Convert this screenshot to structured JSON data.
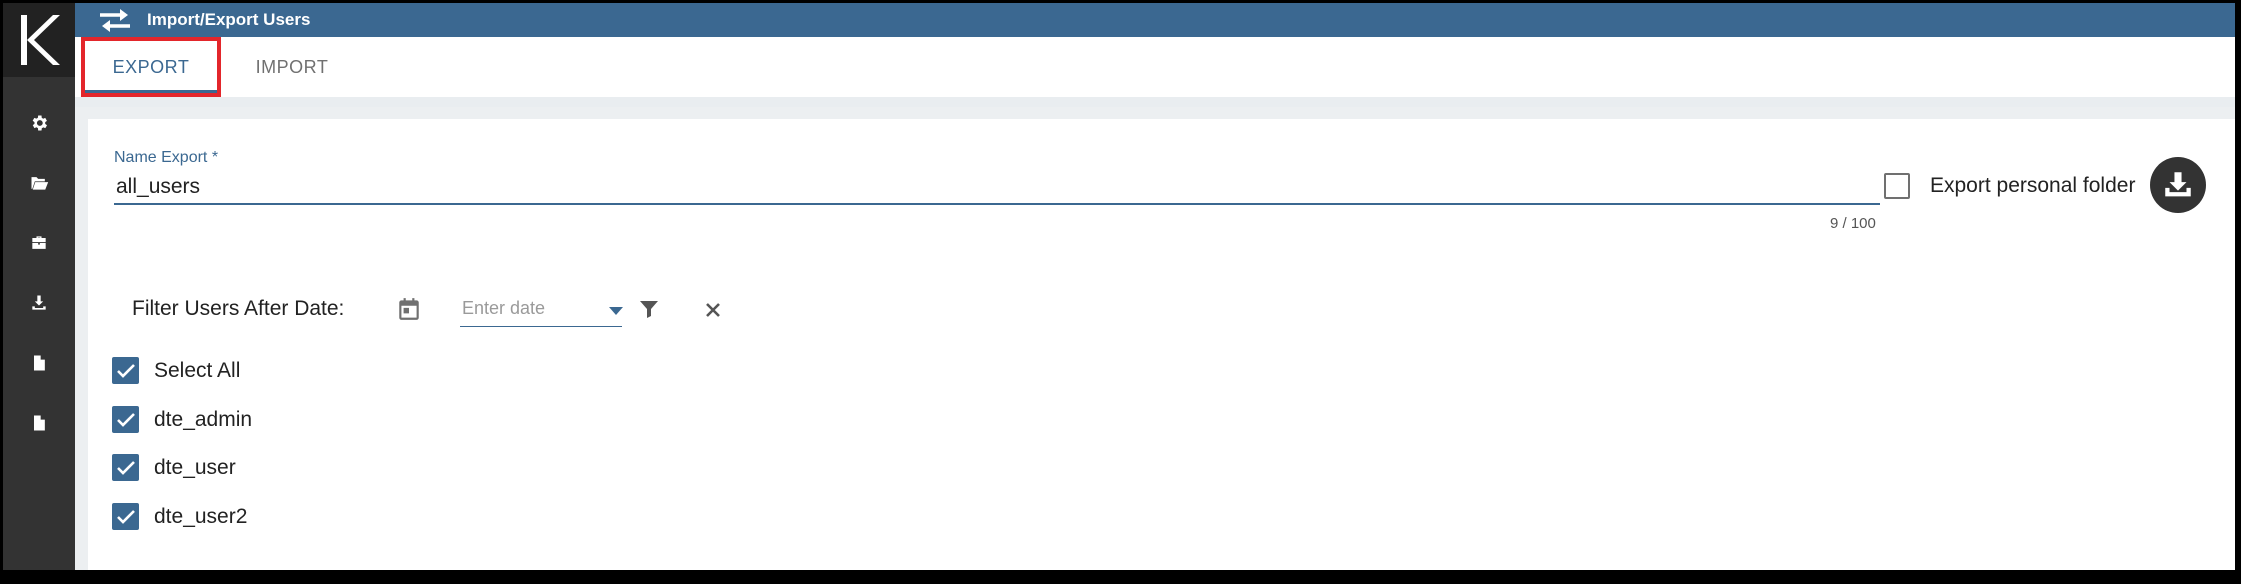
{
  "app": {
    "title": "Import/Export Users",
    "logo_text": "K"
  },
  "sidebar": {
    "items": [
      {
        "icon": "gear-icon"
      },
      {
        "icon": "folder-open-icon"
      },
      {
        "icon": "briefcase-icon"
      },
      {
        "icon": "download-icon"
      },
      {
        "icon": "document-icon"
      },
      {
        "icon": "document-icon"
      }
    ]
  },
  "tabs": [
    {
      "label": "EXPORT",
      "active": true
    },
    {
      "label": "IMPORT",
      "active": false
    }
  ],
  "export_form": {
    "name_label": "Name Export *",
    "name_value": "all_users",
    "counter": "9 / 100",
    "personal_folder_label": "Export personal folder",
    "personal_folder_checked": false,
    "filter_label": "Filter Users After Date:",
    "date_placeholder": "Enter date",
    "users": [
      {
        "label": "Select All",
        "checked": true
      },
      {
        "label": "dte_admin",
        "checked": true
      },
      {
        "label": "dte_user",
        "checked": true
      },
      {
        "label": "dte_user2",
        "checked": true
      }
    ]
  },
  "colors": {
    "accent": "#3b6891",
    "sidebar": "#333333",
    "highlight": "#e3262b"
  }
}
